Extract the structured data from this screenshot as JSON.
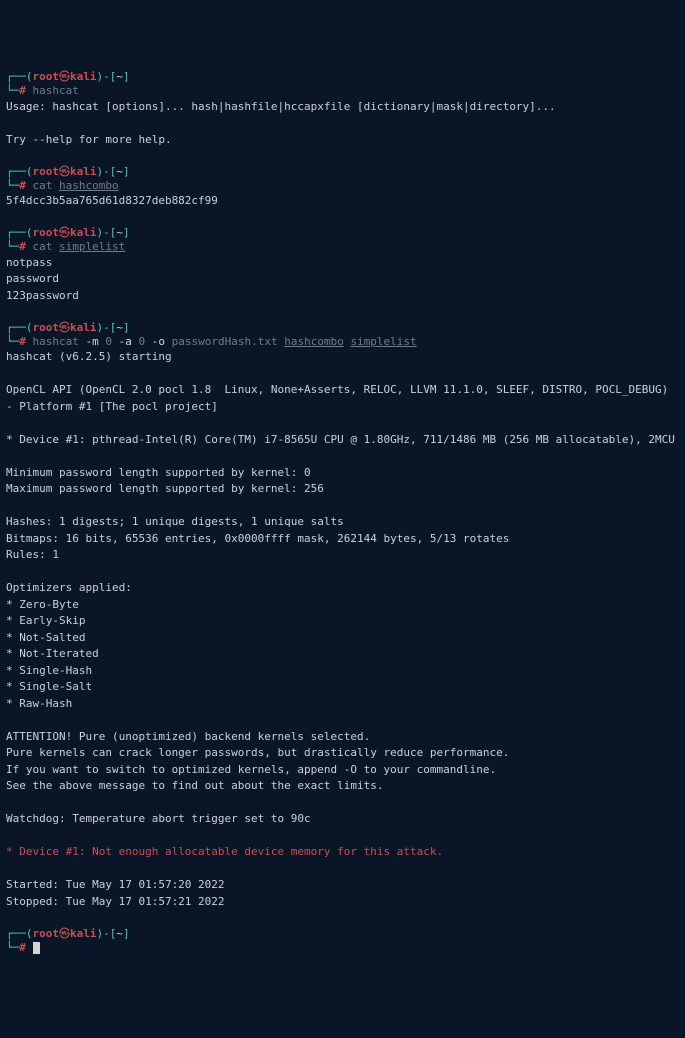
{
  "prompts": {
    "segment_open": "┌──(",
    "user": "root",
    "at": "㉿",
    "host": "kali",
    "segment_close": ")-[",
    "cwd": "~",
    "segment_end": "]",
    "line2_prefix": "└─",
    "hash": "#"
  },
  "commands": {
    "c1": "hashcat",
    "c2_text": "cat ",
    "c2_arg": "hashcombo",
    "c3_text": "cat ",
    "c3_arg": "simplelist",
    "c4_text": "hashcat ",
    "c4_flag_m": "-m",
    "c4_val_m": " 0 ",
    "c4_flag_a": "-a",
    "c4_val_a": " 0 ",
    "c4_flag_o": "-o",
    "c4_val_o": " passwordHash.txt ",
    "c4_arg1": "hashcombo",
    "c4_sep": " ",
    "c4_arg2": "simplelist"
  },
  "out1_l1": "Usage: hashcat [options]... hash|hashfile|hccapxfile [dictionary|mask|directory]...",
  "out1_l2": "Try --help for more help.",
  "out2_l1": "5f4dcc3b5aa765d61d8327deb882cf99",
  "out3_l1": "notpass",
  "out3_l2": "password",
  "out3_l3": "123password",
  "out4_l1": "hashcat (v6.2.5) starting",
  "out4_l2": "OpenCL API (OpenCL 2.0 pocl 1.8  Linux, None+Asserts, RELOC, LLVM 11.1.0, SLEEF, DISTRO, POCL_DEBUG) - Platform #1 [The pocl project]",
  "out4_l3": "* Device #1: pthread-Intel(R) Core(TM) i7-8565U CPU @ 1.80GHz, 711/1486 MB (256 MB allocatable), 2MCU",
  "out4_l4": "Minimum password length supported by kernel: 0",
  "out4_l5": "Maximum password length supported by kernel: 256",
  "out4_l6": "Hashes: 1 digests; 1 unique digests, 1 unique salts",
  "out4_l7": "Bitmaps: 16 bits, 65536 entries, 0x0000ffff mask, 262144 bytes, 5/13 rotates",
  "out4_l8": "Rules: 1",
  "out4_l9": "Optimizers applied:",
  "out4_l10": "* Zero-Byte",
  "out4_l11": "* Early-Skip",
  "out4_l12": "* Not-Salted",
  "out4_l13": "* Not-Iterated",
  "out4_l14": "* Single-Hash",
  "out4_l15": "* Single-Salt",
  "out4_l16": "* Raw-Hash",
  "out4_l17": "ATTENTION! Pure (unoptimized) backend kernels selected.",
  "out4_l18": "Pure kernels can crack longer passwords, but drastically reduce performance.",
  "out4_l19": "If you want to switch to optimized kernels, append -O to your commandline.",
  "out4_l20": "See the above message to find out about the exact limits.",
  "out4_l21": "Watchdog: Temperature abort trigger set to 90c",
  "out4_err": "* Device #1: Not enough allocatable device memory for this attack.",
  "out4_l22": "Started: Tue May 17 01:57:20 2022",
  "out4_l23": "Stopped: Tue May 17 01:57:21 2022"
}
